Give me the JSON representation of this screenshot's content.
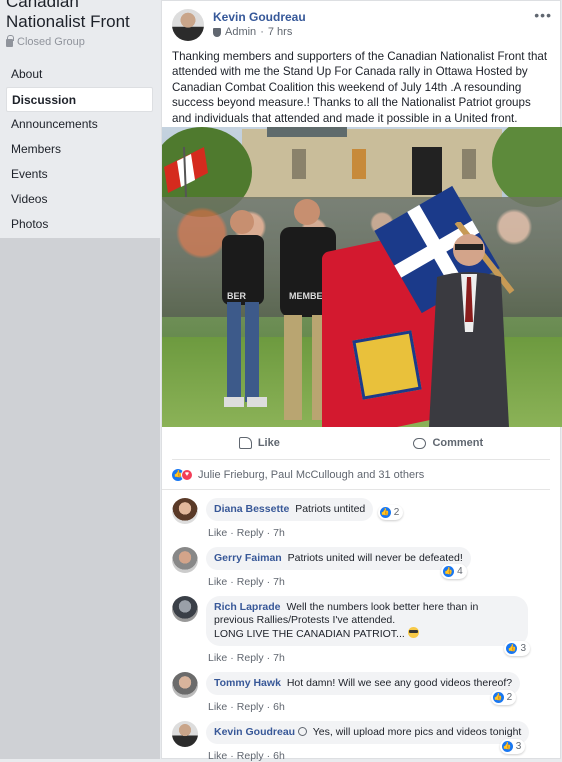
{
  "group": {
    "name": "Canadian Nationalist Front",
    "privacy": "Closed Group"
  },
  "nav": {
    "items": [
      "About",
      "Discussion",
      "Announcements",
      "Members",
      "Events",
      "Videos",
      "Photos"
    ],
    "active": "Discussion"
  },
  "post": {
    "author": "Kevin Goudreau",
    "role": "Admin",
    "time": "7 hrs",
    "more_label": "•••",
    "text": "Thanking members and supporters of the Canadian Nationalist Front that attended with me the Stand Up For Canada rally in Ottawa Hosted by Canadian Combat Coalition this weekend of July 14th .A resounding success beyond measure.! Thanks to all the Nationalist Patriot groups and individuals that attended and made it possible in a United front.",
    "photo_shirt_text_1": "MEMBER",
    "photo_shirt_text_2": "BER"
  },
  "actions": {
    "like_label": "Like",
    "comment_label": "Comment"
  },
  "reactions": {
    "summary": "Julie Frieburg, Paul McCullough and 31 others"
  },
  "comments": [
    {
      "name": "Diana Bessette",
      "text": "Patriots untited",
      "reactions": "2",
      "like": "Like",
      "reply": "Reply",
      "time": "7h"
    },
    {
      "name": "Gerry Faiman",
      "text": "Patriots united will never be defeated!",
      "reactions": "4",
      "like": "Like",
      "reply": "Reply",
      "time": "7h"
    },
    {
      "name": "Rich Laprade",
      "text": "Well the numbers look better here than in previous Rallies/Protests I've attended.",
      "text2": "LONG LIVE THE CANADIAN PATRIOT...",
      "reactions": "3",
      "like": "Like",
      "reply": "Reply",
      "time": "7h"
    },
    {
      "name": "Tommy Hawk",
      "text": "Hot damn! Will we see any good videos thereof?",
      "reactions": "2",
      "like": "Like",
      "reply": "Reply",
      "time": "6h"
    },
    {
      "name": "Kevin Goudreau",
      "text": "Yes, will upload more pics and videos tonight",
      "reactions": "3",
      "like": "Like",
      "reply": "Reply",
      "time": "6h"
    }
  ],
  "colors": {
    "link_blue": "#365899",
    "sidebar_bg": "#cfd1d5",
    "like_blue": "#1877f2",
    "love_red": "#f33e58"
  }
}
